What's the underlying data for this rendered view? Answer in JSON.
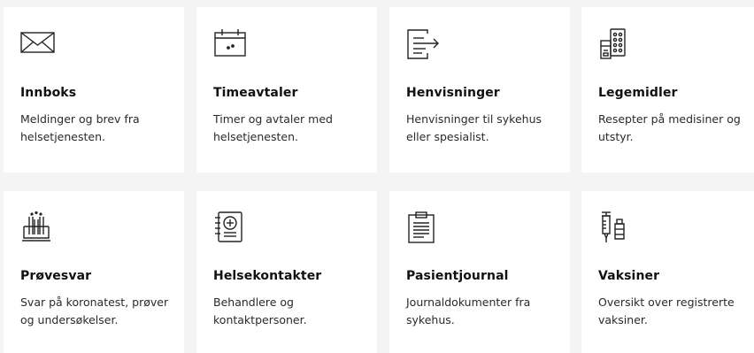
{
  "cards": [
    {
      "title": "Innboks",
      "description": "Meldinger og brev fra helsetjenesten.",
      "icon": "envelope-icon"
    },
    {
      "title": "Timeavtaler",
      "description": "Timer og avtaler med helsetjenesten.",
      "icon": "calendar-icon"
    },
    {
      "title": "Henvisninger",
      "description": "Henvisninger til sykehus eller spesialist.",
      "icon": "referral-document-icon"
    },
    {
      "title": "Legemidler",
      "description": "Resepter på medisiner og utstyr.",
      "icon": "pill-box-icon"
    },
    {
      "title": "Prøvesvar",
      "description": "Svar på koronatest, prøver og undersøkelser.",
      "icon": "test-tubes-icon"
    },
    {
      "title": "Helsekontakter",
      "description": "Behandlere og kontaktpersoner.",
      "icon": "contact-book-icon"
    },
    {
      "title": "Pasientjournal",
      "description": "Journaldokumenter fra sykehus.",
      "icon": "clipboard-journal-icon"
    },
    {
      "title": "Vaksiner",
      "description": "Oversikt over registrerte vaksiner.",
      "icon": "syringe-vial-icon"
    }
  ],
  "colors": {
    "background": "#f4f4f4",
    "card": "#ffffff",
    "text": "#222222",
    "icon_stroke": "#222222"
  }
}
